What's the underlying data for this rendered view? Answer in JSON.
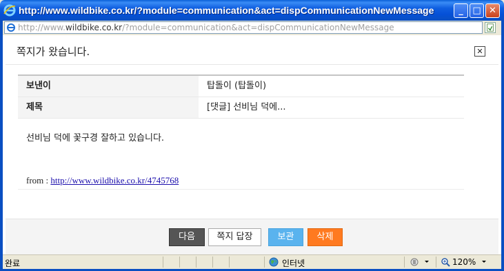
{
  "window": {
    "title": "http://www.wildbike.co.kr/?module=communication&act=dispCommunicationNewMessage",
    "minimize_label": "_",
    "maximize_label": "□",
    "close_label": "✕"
  },
  "address": {
    "prefix": "http://www.",
    "domain": "wildbike.co.kr",
    "path": "/?module=communication&act=dispCommunicationNewMessage"
  },
  "page": {
    "title": "쪽지가 왔습니다.",
    "close_label": "✕",
    "rows": [
      {
        "label": "보낸이",
        "value": "탑돌이 (탑돌이)"
      },
      {
        "label": "제목",
        "value": "[댓글] 선비님 덕에..."
      }
    ],
    "body": "선비님 덕에 꽃구경 잘하고 있습니다.",
    "from_label": "from : ",
    "from_link": "http://www.wildbike.co.kr/4745768"
  },
  "buttons": {
    "next": "다음",
    "reply": "쪽지 답장",
    "save": "보관",
    "delete": "삭제"
  },
  "status": {
    "text": "완료",
    "zone": "인터넷",
    "zoom": "120%"
  },
  "colors": {
    "titlebar": "#0550d6",
    "btn_next": "#555555",
    "btn_save": "#5ab3ee",
    "btn_delete": "#ff7a20",
    "link": "#1a0dab"
  },
  "icons": [
    "ie-logo-icon",
    "page-icon",
    "go-icon",
    "close-icon",
    "globe-icon",
    "popup-blocker-icon",
    "zoom-icon"
  ]
}
